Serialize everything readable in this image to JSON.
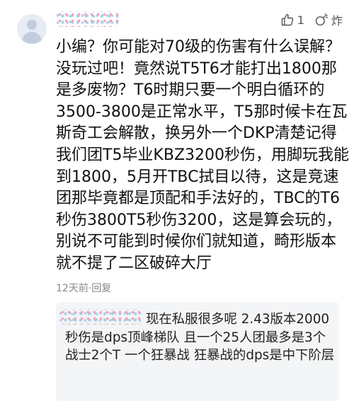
{
  "comment": {
    "text": "小编？你可能对70级的伤害有什么误解？没玩过吧！竟然说T5T6才能打出1800那是多废物？T6时期只要一个明白循环的3500-3800是正常水平，T5那时候卡在瓦斯奇工会解散，换另外一个DKP清楚记得我们团T5毕业KBZ3200秒伤，用脚玩我能到1800，5月开TBC拭目以待，这是竞速团那毕竟都是顶配和手法好的，TBC的T6秒伤3800T5秒伤3200，这是算会玩的，别说不可能到时候你们就知道，畸形版本就不提了二区破碎大厅",
    "time": "12天前",
    "separator": "·",
    "reply_label": "回复"
  },
  "actions": {
    "like_count": "1",
    "bomb_label": "炸",
    "icons": [
      "thumb-up-icon",
      "bomb-icon"
    ]
  },
  "reply": {
    "text": "现在私服很多呢 2.43版本2000秒伤是dps顶峰梯队 且一个25人团最多是3个战士2个T 一个狂暴战 狂暴战的dps是中下阶层"
  },
  "colors": {
    "meta_gray": "#888888",
    "reply_bg": "#f4f5f7",
    "avatar_bg": "#e7ebf3"
  }
}
